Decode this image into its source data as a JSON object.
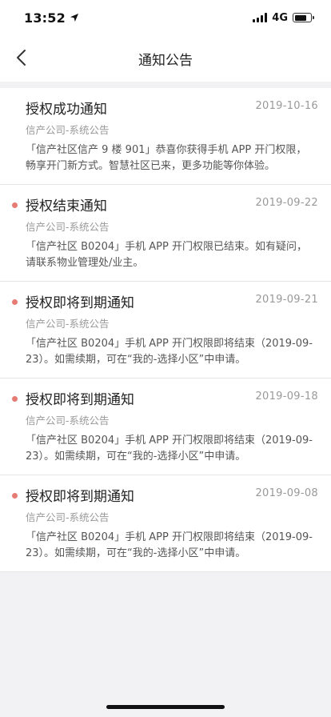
{
  "status_bar": {
    "time": "13:52",
    "network": "4G",
    "battery_level": 0.75,
    "signal_bars": 4
  },
  "nav": {
    "title": "通知公告"
  },
  "notices": [
    {
      "title": "授权成功通知",
      "date": "2019-10-16",
      "source": "信产公司-系统公告",
      "body": "「信产社区信产 9 楼 901」恭喜你获得手机 APP 开门权限，畅享开门新方式。智慧社区已来，更多功能等你体验。",
      "unread": false
    },
    {
      "title": "授权结束通知",
      "date": "2019-09-22",
      "source": "信产公司-系统公告",
      "body": "「信产社区 B0204」手机 APP 开门权限已结束。如有疑问，请联系物业管理处/业主。",
      "unread": true
    },
    {
      "title": "授权即将到期通知",
      "date": "2019-09-21",
      "source": "信产公司-系统公告",
      "body": "「信产社区 B0204」手机 APP 开门权限即将结束（2019-09-23）。如需续期，可在“我的-选择小区”中申请。",
      "unread": true
    },
    {
      "title": "授权即将到期通知",
      "date": "2019-09-18",
      "source": "信产公司-系统公告",
      "body": "「信产社区 B0204」手机 APP 开门权限即将结束（2019-09-23）。如需续期，可在“我的-选择小区”中申请。",
      "unread": true
    },
    {
      "title": "授权即将到期通知",
      "date": "2019-09-08",
      "source": "信产公司-系统公告",
      "body": "「信产社区 B0204」手机 APP 开门权限即将结束（2019-09-23）。如需续期，可在“我的-选择小区”中申请。",
      "unread": true
    }
  ],
  "colors": {
    "unread_dot": "#e67b74",
    "background": "#f2f2f4",
    "card": "#ffffff",
    "secondary_text": "#999999"
  }
}
